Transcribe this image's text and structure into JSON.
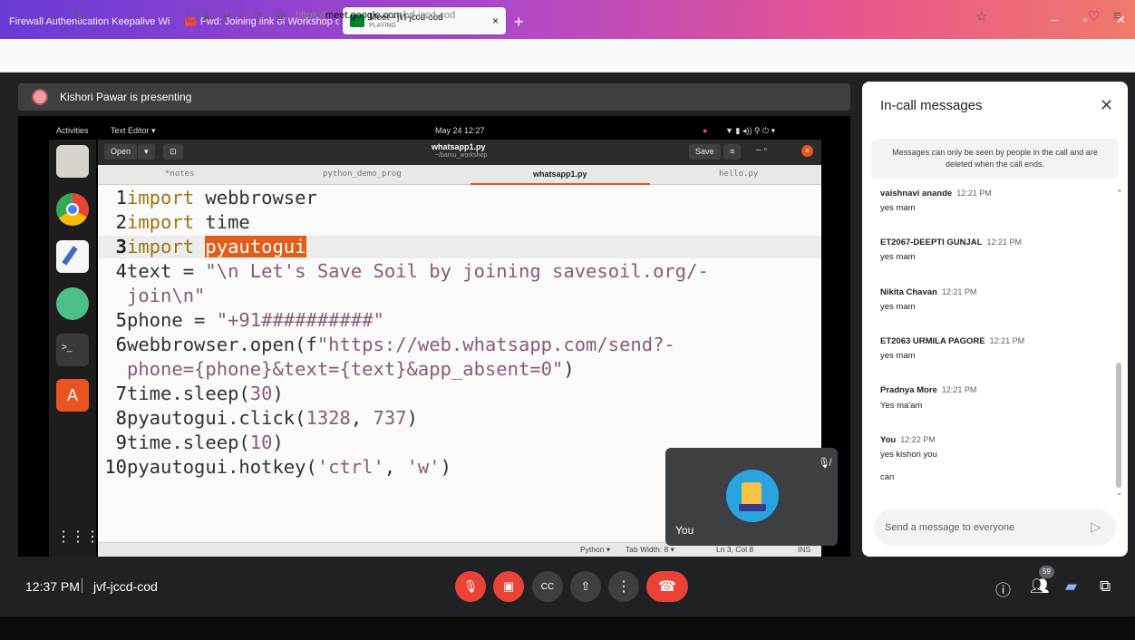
{
  "browser": {
    "tabs": [
      {
        "label": "Firewall Authentication Keepalive Wi"
      },
      {
        "label": "Fwd: Joining link of Workshop o"
      },
      {
        "label": "Meet - jvf-jccd-cod",
        "sub": "PLAYING"
      }
    ],
    "url_prefix": "https://",
    "url_host": "meet.google.com",
    "url_path": "/jvf-jccd-cod"
  },
  "presenter": {
    "text": "Kishori Pawar is presenting"
  },
  "shared_screen": {
    "top_bar": {
      "activities": "Activities",
      "app": "Text Editor ▾",
      "datetime": "May 24  12:27"
    },
    "header": {
      "open": "Open",
      "filename": "whatsapp1.py",
      "path": "~/bamu_workshop",
      "save": "Save"
    },
    "editor_tabs": [
      "*notes",
      "python_demo_prog",
      "whatsapp1.py",
      "hello.py"
    ],
    "code": {
      "l1": {
        "n": "1",
        "kw": "import",
        "rest": " webbrowser"
      },
      "l2": {
        "n": "2",
        "kw": "import",
        "rest": " time"
      },
      "l3": {
        "n": "3",
        "kw": "import",
        "sel": "pyautogui"
      },
      "l4": {
        "n": "4",
        "a": "text = ",
        "s1": "\"\\n Let's Save Soil by joining savesoil.org/-",
        "s2": "join\\n\""
      },
      "l5": {
        "n": "5",
        "a": "phone = ",
        "s": "\"+91##########\""
      },
      "l6": {
        "n": "6",
        "a": "webbrowser.open(f",
        "s1": "\"https://web.whatsapp.com/send?-",
        "s2": "phone={phone}&text={text}&app_absent=0\"",
        "b": ")"
      },
      "l7": {
        "n": "7",
        "a": "time.sleep(",
        "num": "30",
        "b": ")"
      },
      "l8": {
        "n": "8",
        "a": "pyautogui.click(",
        "num": "1328",
        "c": ", ",
        "num2": "737",
        "b": ")"
      },
      "l9": {
        "n": "9",
        "a": "time.sleep(",
        "num": "10",
        "b": ")"
      },
      "l10": {
        "n": "10",
        "a": "pyautogui.hotkey(",
        "s": "'ctrl'",
        "c": ", ",
        "s2": "'w'",
        "b": ")"
      }
    },
    "status": {
      "lang": "Python ▾",
      "tabwidth": "Tab Width: 8 ▾",
      "pos": "Ln 3, Col 8",
      "mode": "INS"
    }
  },
  "self_view": {
    "name": "You"
  },
  "chat": {
    "title": "In-call messages",
    "info": "Messages can only be seen by people in the call and are deleted when the call ends.",
    "messages": [
      {
        "sender": "vaishnavi anande",
        "time": "12:21 PM",
        "text": "yes mam"
      },
      {
        "sender": "ET2067-DEEPTI GUNJAL",
        "time": "12:21 PM",
        "text": "yes mam"
      },
      {
        "sender": "Nikita Chavan",
        "time": "12:21 PM",
        "text": "yes mam"
      },
      {
        "sender": "ET2063 URMILA PAGORE",
        "time": "12:21 PM",
        "text": "yes mam"
      },
      {
        "sender": "Pradnya More",
        "time": "12:21 PM",
        "text": "Yes ma'am"
      },
      {
        "sender": "You",
        "time": "12:22 PM",
        "text": "yes kishori you",
        "text2": "can"
      }
    ],
    "placeholder": "Send a message to everyone"
  },
  "bottom": {
    "clock": "12:37 PM",
    "meeting_code": "jvf-jccd-cod",
    "participants": "59"
  },
  "colors": {
    "hangup": "#ea4335",
    "chat_accent": "#1a73e8"
  }
}
